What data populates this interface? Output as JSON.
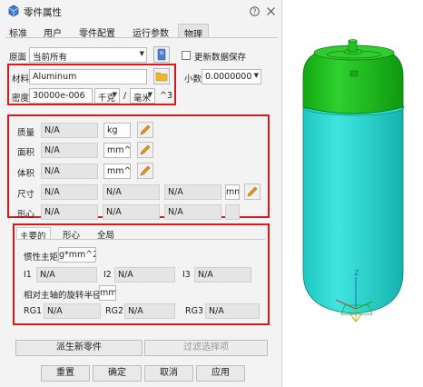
{
  "window": {
    "title": "零件属性"
  },
  "tabs": [
    "标准",
    "用户",
    "零件配置",
    "运行参数",
    "物理"
  ],
  "active_tab": "物理",
  "origin": {
    "label": "原面",
    "value": "当前所有"
  },
  "update_checkbox": {
    "label": "更新数据保存",
    "checked": false
  },
  "decimal": {
    "label": "小数",
    "value": "0.0000000"
  },
  "material": {
    "label": "材料",
    "value": "Aluminum"
  },
  "density": {
    "label": "密度",
    "value": "30000e-006",
    "unit1": "千克",
    "separator": "/",
    "unit2": "毫米",
    "power": "^3"
  },
  "mass_props": [
    {
      "label": "质量",
      "value": "N/A",
      "unit": "kg"
    },
    {
      "label": "面积",
      "value": "N/A",
      "unit": "mm^2"
    },
    {
      "label": "体积",
      "value": "N/A",
      "unit": "mm^3"
    }
  ],
  "dimension": {
    "label": "尺寸",
    "values": [
      "N/A",
      "N/A",
      "N/A"
    ],
    "unit": "mm"
  },
  "centroid": {
    "label": "形心",
    "values": [
      "N/A",
      "N/A",
      "N/A"
    ]
  },
  "subtabs": [
    "主要的",
    "形心",
    "全局"
  ],
  "active_subtab": "主要的",
  "inertia": {
    "label": "惯性主矩",
    "unit": "g*mm^2",
    "i1_label": "I1",
    "i1": "N/A",
    "i2_label": "I2",
    "i2": "N/A",
    "i3_label": "I3",
    "i3": "N/A"
  },
  "gyration": {
    "label": "相对主轴的旋转半径",
    "unit": "mm",
    "rg1_label": "RG1",
    "rg1": "N/A",
    "rg2_label": "RG2",
    "rg2": "N/A",
    "rg3_label": "RG3",
    "rg3": "N/A"
  },
  "buttons": {
    "derive": "派生新零件",
    "filter": "过滤选择项",
    "reset": "重置",
    "ok": "确定",
    "cancel": "取消",
    "apply": "应用"
  },
  "colors": {
    "highlight_box": "#d71a1a",
    "model_top": "#18b818",
    "model_body": "#29d8d0"
  },
  "icons": [
    "part-icon",
    "help-icon",
    "close-icon",
    "book-icon",
    "folder-icon",
    "pencil-icon"
  ]
}
